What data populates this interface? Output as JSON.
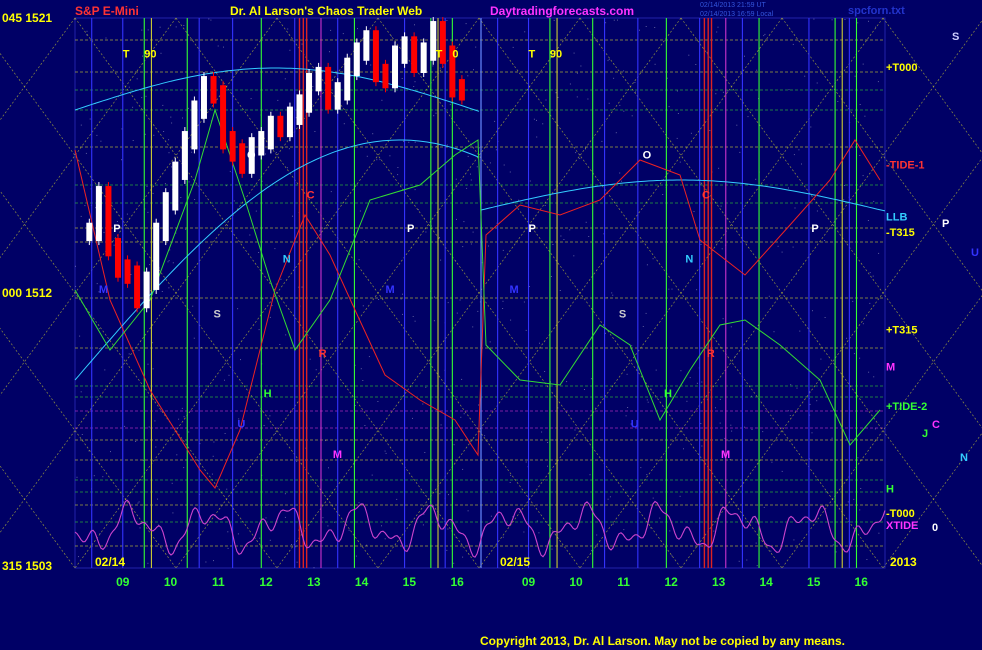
{
  "header": {
    "symbol": "S&P E-Mini",
    "site_title": "Dr. Al Larson's Chaos Trader Web",
    "site_url": "Daytradingforecasts.com",
    "timestamp_1": "02/14/2013 21:59 UT",
    "timestamp_2": "02/14/2013 16:59 Local",
    "spc_file": "spcforn.txt"
  },
  "copyright": "Copyright 2013, Dr. Al Larson. May not be copied by any means.",
  "colors": {
    "background": "#000066",
    "grid_yellow": "#cccc33",
    "grid_green": "#33cc33",
    "vertical_blue": "#3333ff",
    "vertical_green": "#33ff33",
    "vertical_red": "#dd2222",
    "vertical_magenta": "#cc33cc",
    "price_up": "#ffffff",
    "price_down": "#ff0000",
    "cyan_line": "#33ccff",
    "tide_red": "#ee2222",
    "tide_green": "#33dd33",
    "xtide_magenta": "#cc44cc"
  },
  "chart_data": {
    "type": "line",
    "title": "S&P E-Mini",
    "y_axis": {
      "ylim": [
        1503,
        1521
      ],
      "ticks": [
        {
          "label": "045 1521",
          "value": 1521
        },
        {
          "label": "000 1512",
          "value": 1512
        },
        {
          "label": "315 1503",
          "value": 1503
        }
      ]
    },
    "x_axis": {
      "hour_ticks": [
        "09",
        "10",
        "11",
        "12",
        "13",
        "14",
        "15",
        "16",
        "09",
        "10",
        "11",
        "12",
        "13",
        "14",
        "15",
        "16"
      ],
      "date_labels": [
        "02/14",
        "02/15"
      ],
      "year": "2013"
    },
    "price_series": {
      "name": "S&P E-Mini",
      "x_hours": [
        8.3,
        8.5,
        8.7,
        8.9,
        9.1,
        9.3,
        9.5,
        9.7,
        9.9,
        10.1,
        10.3,
        10.5,
        10.7,
        10.9,
        11.1,
        11.3,
        11.5,
        11.7,
        11.9,
        12.1,
        12.3,
        12.5,
        12.7,
        12.9,
        13.1,
        13.3,
        13.5,
        13.7,
        13.9,
        14.1,
        14.3,
        14.5,
        14.7,
        14.9,
        15.1,
        15.3,
        15.5,
        15.7,
        15.9,
        16.1
      ],
      "values": [
        1514.0,
        1515.2,
        1513.5,
        1512.8,
        1512.6,
        1511.8,
        1512.4,
        1514.0,
        1515.0,
        1516.0,
        1517.0,
        1518.0,
        1518.8,
        1518.5,
        1517.0,
        1516.6,
        1516.2,
        1516.8,
        1517.0,
        1517.5,
        1517.4,
        1517.8,
        1518.2,
        1518.9,
        1519.1,
        1518.3,
        1518.6,
        1519.4,
        1519.9,
        1520.3,
        1519.2,
        1519.0,
        1519.8,
        1520.1,
        1519.5,
        1519.9,
        1520.6,
        1519.8,
        1518.7,
        1518.6
      ]
    },
    "right_labels": [
      {
        "text": "+T000",
        "color": "#ffff00",
        "value": 1519.4
      },
      {
        "text": "-TIDE-1",
        "color": "#ff3333",
        "value": 1516.2
      },
      {
        "text": "LLB",
        "color": "#33ccff",
        "value": 1514.5
      },
      {
        "text": "-T315",
        "color": "#ffff00",
        "value": 1514.0
      },
      {
        "text": "+T315",
        "color": "#ffff00",
        "value": 1510.8
      },
      {
        "text": "M",
        "color": "#ff33ff",
        "value": 1509.6
      },
      {
        "text": "+TIDE-2",
        "color": "#33ff33",
        "value": 1508.3
      },
      {
        "text": "H",
        "color": "#33ff33",
        "value": 1505.6
      },
      {
        "text": "-T000",
        "color": "#ffff00",
        "value": 1504.8
      },
      {
        "text": "XTIDE",
        "color": "#ff33ff",
        "value": 1504.4
      }
    ],
    "outside_planet_labels": [
      {
        "text": "S",
        "color": "#ccccff"
      },
      {
        "text": "P",
        "color": "#ffffff"
      },
      {
        "text": "U",
        "color": "#3333ff"
      },
      {
        "text": "J",
        "color": "#33ff33"
      },
      {
        "text": "C",
        "color": "#ff33ff"
      },
      {
        "text": "N",
        "color": "#33ccff"
      },
      {
        "text": "0",
        "color": "#ffffff"
      }
    ],
    "in_chart_labels": [
      {
        "text": "T",
        "color": "#ffff00",
        "x": 9.0,
        "value": 1519.7
      },
      {
        "text": "90",
        "color": "#ffff00",
        "x": 9.45,
        "value": 1519.7
      },
      {
        "text": "T",
        "color": "#ffff00",
        "x": 15.55,
        "value": 1519.7
      },
      {
        "text": "0",
        "color": "#ffff00",
        "x": 15.9,
        "value": 1519.7
      },
      {
        "text": "P",
        "color": "#ffffff",
        "x": 8.8,
        "value": 1514.0
      },
      {
        "text": "M",
        "color": "#3333ff",
        "x": 8.5,
        "value": 1512.0
      },
      {
        "text": "O",
        "color": "#ffffff",
        "x": 11.6,
        "value": 1516.4
      },
      {
        "text": "C",
        "color": "#ff3333",
        "x": 12.85,
        "value": 1515.1
      },
      {
        "text": "N",
        "color": "#33ccff",
        "x": 12.35,
        "value": 1513.0
      },
      {
        "text": "S",
        "color": "#cccccc",
        "x": 10.9,
        "value": 1511.2
      },
      {
        "text": "P",
        "color": "#ffffff",
        "x": 14.95,
        "value": 1514.0
      },
      {
        "text": "M",
        "color": "#3333ff",
        "x": 14.5,
        "value": 1512.0
      },
      {
        "text": "R",
        "color": "#ff3333",
        "x": 13.1,
        "value": 1509.9
      },
      {
        "text": "H",
        "color": "#33ff33",
        "x": 11.95,
        "value": 1508.6
      },
      {
        "text": "M",
        "color": "#ff33ff",
        "x": 13.4,
        "value": 1506.6
      },
      {
        "text": "U",
        "color": "#3333ff",
        "x": 11.4,
        "value": 1507.6
      },
      {
        "text": "T",
        "color": "#ffff00",
        "x": 9.0,
        "value": 1519.7
      },
      {
        "text": "90",
        "color": "#ffff00",
        "x": 9.45,
        "value": 1519.7
      },
      {
        "text": "P",
        "color": "#ffffff",
        "x": 9.0,
        "value": 1514.0
      },
      {
        "text": "M",
        "color": "#3333ff",
        "x": 8.6,
        "value": 1512.0
      },
      {
        "text": "O",
        "color": "#ffffff",
        "x": 11.4,
        "value": 1516.4
      },
      {
        "text": "C",
        "color": "#ff3333",
        "x": 12.65,
        "value": 1515.1
      },
      {
        "text": "N",
        "color": "#33ccff",
        "x": 12.3,
        "value": 1513.0
      },
      {
        "text": "S",
        "color": "#cccccc",
        "x": 10.9,
        "value": 1511.2
      },
      {
        "text": "P",
        "color": "#ffffff",
        "x": 14.95,
        "value": 1514.0
      },
      {
        "text": "R",
        "color": "#ff3333",
        "x": 12.75,
        "value": 1509.9
      },
      {
        "text": "H",
        "color": "#33ff33",
        "x": 11.85,
        "value": 1508.6
      },
      {
        "text": "M",
        "color": "#ff33ff",
        "x": 13.05,
        "value": 1506.6
      },
      {
        "text": "U",
        "color": "#3333ff",
        "x": 11.15,
        "value": 1507.6
      }
    ]
  }
}
